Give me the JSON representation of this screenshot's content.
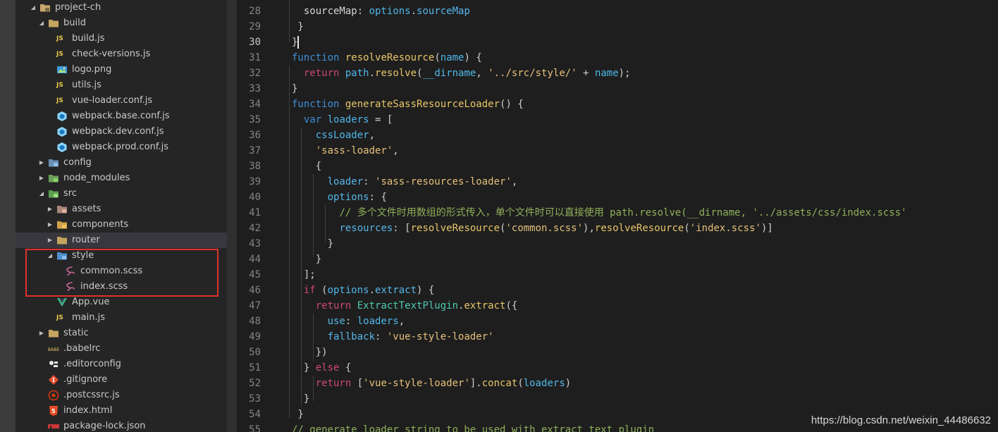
{
  "explorer": {
    "items": [
      {
        "label": "project-ch",
        "depth": 0,
        "type": "folder-open",
        "icon": "project-folder-icon"
      },
      {
        "label": "build",
        "depth": 1,
        "type": "folder-open",
        "icon": "folder-icon"
      },
      {
        "label": "build.js",
        "depth": 2,
        "type": "file",
        "icon": "js-file-icon"
      },
      {
        "label": "check-versions.js",
        "depth": 2,
        "type": "file",
        "icon": "js-file-icon"
      },
      {
        "label": "logo.png",
        "depth": 2,
        "type": "file",
        "icon": "image-file-icon"
      },
      {
        "label": "utils.js",
        "depth": 2,
        "type": "file",
        "icon": "js-file-icon"
      },
      {
        "label": "vue-loader.conf.js",
        "depth": 2,
        "type": "file",
        "icon": "js-file-icon"
      },
      {
        "label": "webpack.base.conf.js",
        "depth": 2,
        "type": "file",
        "icon": "webpack-icon"
      },
      {
        "label": "webpack.dev.conf.js",
        "depth": 2,
        "type": "file",
        "icon": "webpack-icon"
      },
      {
        "label": "webpack.prod.conf.js",
        "depth": 2,
        "type": "file",
        "icon": "webpack-icon"
      },
      {
        "label": "config",
        "depth": 1,
        "type": "folder-closed",
        "icon": "config-folder-icon"
      },
      {
        "label": "node_modules",
        "depth": 1,
        "type": "folder-closed",
        "icon": "node-folder-icon"
      },
      {
        "label": "src",
        "depth": 1,
        "type": "folder-open",
        "icon": "src-folder-icon"
      },
      {
        "label": "assets",
        "depth": 2,
        "type": "folder-closed",
        "icon": "assets-folder-icon"
      },
      {
        "label": "components",
        "depth": 2,
        "type": "folder-closed",
        "icon": "components-folder-icon"
      },
      {
        "label": "router",
        "depth": 2,
        "type": "folder-closed",
        "icon": "folder-icon",
        "selected": true
      },
      {
        "label": "style",
        "depth": 2,
        "type": "folder-open",
        "icon": "style-folder-icon"
      },
      {
        "label": "common.scss",
        "depth": 3,
        "type": "file",
        "icon": "sass-file-icon"
      },
      {
        "label": "index.scss",
        "depth": 3,
        "type": "file",
        "icon": "sass-file-icon"
      },
      {
        "label": "App.vue",
        "depth": 2,
        "type": "file",
        "icon": "vue-file-icon"
      },
      {
        "label": "main.js",
        "depth": 2,
        "type": "file",
        "icon": "js-file-icon"
      },
      {
        "label": "static",
        "depth": 1,
        "type": "folder-closed",
        "icon": "folder-icon"
      },
      {
        "label": ".babelrc",
        "depth": 1,
        "type": "file",
        "icon": "babel-file-icon"
      },
      {
        "label": ".editorconfig",
        "depth": 1,
        "type": "file",
        "icon": "editorconfig-icon"
      },
      {
        "label": ".gitignore",
        "depth": 1,
        "type": "file",
        "icon": "git-file-icon"
      },
      {
        "label": ".postcssrc.js",
        "depth": 1,
        "type": "file",
        "icon": "postcss-file-icon"
      },
      {
        "label": "index.html",
        "depth": 1,
        "type": "file",
        "icon": "html-file-icon"
      },
      {
        "label": "package-lock.json",
        "depth": 1,
        "type": "file",
        "icon": "npm-file-icon"
      }
    ],
    "js_badge": "JS"
  },
  "editor": {
    "current_line": 30,
    "lines": [
      {
        "n": "28",
        "tokens": [
          [
            "  ",
            ""
          ],
          [
            "sourceMap",
            ""
          ],
          [
            ": ",
            "punc"
          ],
          [
            "options",
            "var"
          ],
          [
            ".",
            "punc"
          ],
          [
            "sourceMap",
            "prop"
          ]
        ]
      },
      {
        "n": "29",
        "tokens": [
          [
            " }",
            "punc"
          ]
        ]
      },
      {
        "n": "30",
        "tokens": [
          [
            "}",
            "punc"
          ]
        ]
      },
      {
        "n": "31",
        "tokens": [
          [
            "function",
            "blue"
          ],
          [
            " ",
            ""
          ],
          [
            "resolveResource",
            "fn"
          ],
          [
            "(",
            "punc"
          ],
          [
            "name",
            "var"
          ],
          [
            ") {",
            "punc"
          ]
        ]
      },
      {
        "n": "32",
        "tokens": [
          [
            "  ",
            ""
          ],
          [
            "return",
            "kw"
          ],
          [
            " ",
            ""
          ],
          [
            "path",
            "var"
          ],
          [
            ".",
            "punc"
          ],
          [
            "resolve",
            "fn"
          ],
          [
            "(",
            "punc"
          ],
          [
            "__dirname",
            "var"
          ],
          [
            ", ",
            "punc"
          ],
          [
            "'../src/style/'",
            "str"
          ],
          [
            " + ",
            "punc"
          ],
          [
            "name",
            "var"
          ],
          [
            ");",
            "punc"
          ]
        ]
      },
      {
        "n": "33",
        "tokens": [
          [
            "}",
            "punc"
          ]
        ]
      },
      {
        "n": "34",
        "tokens": [
          [
            "function",
            "blue"
          ],
          [
            " ",
            ""
          ],
          [
            "generateSassResourceLoader",
            "fn"
          ],
          [
            "() {",
            "punc"
          ]
        ]
      },
      {
        "n": "35",
        "tokens": [
          [
            "  ",
            ""
          ],
          [
            "var",
            "blue"
          ],
          [
            " ",
            ""
          ],
          [
            "loaders",
            "var"
          ],
          [
            " = [",
            "punc"
          ]
        ]
      },
      {
        "n": "36",
        "tokens": [
          [
            "    ",
            ""
          ],
          [
            "cssLoader",
            "var"
          ],
          [
            ",",
            "punc"
          ]
        ]
      },
      {
        "n": "37",
        "tokens": [
          [
            "    ",
            ""
          ],
          [
            "'sass-loader'",
            "str"
          ],
          [
            ",",
            "punc"
          ]
        ]
      },
      {
        "n": "38",
        "tokens": [
          [
            "    ",
            ""
          ],
          [
            "{",
            "punc"
          ]
        ]
      },
      {
        "n": "39",
        "tokens": [
          [
            "      ",
            ""
          ],
          [
            "loader",
            "prop"
          ],
          [
            ": ",
            "punc"
          ],
          [
            "'sass-resources-loader'",
            "str"
          ],
          [
            ",",
            "punc"
          ]
        ]
      },
      {
        "n": "40",
        "tokens": [
          [
            "      ",
            ""
          ],
          [
            "options",
            "prop"
          ],
          [
            ": {",
            "punc"
          ]
        ]
      },
      {
        "n": "41",
        "tokens": [
          [
            "        ",
            ""
          ],
          [
            "// 多个文件时用数组的形式传入，单个文件时可以直接使用 path.resolve(__dirname, '../assets/css/index.scss'",
            "cm"
          ]
        ]
      },
      {
        "n": "42",
        "tokens": [
          [
            "        ",
            ""
          ],
          [
            "resources",
            "prop"
          ],
          [
            ": [",
            "punc"
          ],
          [
            "resolveResource",
            "fn"
          ],
          [
            "(",
            "punc"
          ],
          [
            "'common.scss'",
            "str"
          ],
          [
            "),",
            "punc"
          ],
          [
            "resolveResource",
            "fn"
          ],
          [
            "(",
            "punc"
          ],
          [
            "'index.scss'",
            "str"
          ],
          [
            ")]",
            "punc"
          ]
        ]
      },
      {
        "n": "43",
        "tokens": [
          [
            "      ",
            ""
          ],
          [
            "}",
            "punc"
          ]
        ]
      },
      {
        "n": "44",
        "tokens": [
          [
            "    ",
            ""
          ],
          [
            "}",
            "punc"
          ]
        ]
      },
      {
        "n": "45",
        "tokens": [
          [
            "  ",
            ""
          ],
          [
            "];",
            "punc"
          ]
        ]
      },
      {
        "n": "46",
        "tokens": [
          [
            "  ",
            ""
          ],
          [
            "if",
            "kw"
          ],
          [
            " (",
            "punc"
          ],
          [
            "options",
            "var"
          ],
          [
            ".",
            "punc"
          ],
          [
            "extract",
            "prop"
          ],
          [
            ") {",
            "punc"
          ]
        ]
      },
      {
        "n": "47",
        "tokens": [
          [
            "    ",
            ""
          ],
          [
            "return",
            "kw"
          ],
          [
            " ",
            ""
          ],
          [
            "ExtractTextPlugin",
            "cls"
          ],
          [
            ".",
            "punc"
          ],
          [
            "extract",
            "fn"
          ],
          [
            "({",
            "punc"
          ]
        ]
      },
      {
        "n": "48",
        "tokens": [
          [
            "      ",
            ""
          ],
          [
            "use",
            "prop"
          ],
          [
            ": ",
            "punc"
          ],
          [
            "loaders",
            "var"
          ],
          [
            ",",
            "punc"
          ]
        ]
      },
      {
        "n": "49",
        "tokens": [
          [
            "      ",
            ""
          ],
          [
            "fallback",
            "prop"
          ],
          [
            ": ",
            "punc"
          ],
          [
            "'vue-style-loader'",
            "str"
          ]
        ]
      },
      {
        "n": "50",
        "tokens": [
          [
            "    ",
            ""
          ],
          [
            "})",
            "punc"
          ]
        ]
      },
      {
        "n": "51",
        "tokens": [
          [
            "  ",
            ""
          ],
          [
            "} ",
            "punc"
          ],
          [
            "else",
            "kw"
          ],
          [
            " {",
            "punc"
          ]
        ]
      },
      {
        "n": "52",
        "tokens": [
          [
            "    ",
            ""
          ],
          [
            "return",
            "kw"
          ],
          [
            " [",
            "punc"
          ],
          [
            "'vue-style-loader'",
            "str"
          ],
          [
            "].",
            "punc"
          ],
          [
            "concat",
            "fn"
          ],
          [
            "(",
            "punc"
          ],
          [
            "loaders",
            "var"
          ],
          [
            ")",
            "punc"
          ]
        ]
      },
      {
        "n": "53",
        "tokens": [
          [
            "  ",
            ""
          ],
          [
            "}",
            "punc"
          ]
        ]
      },
      {
        "n": "54",
        "tokens": [
          [
            " }",
            "punc"
          ]
        ]
      },
      {
        "n": "55",
        "tokens": [
          [
            "// generate loader string to be used with extract text plugin",
            "cm"
          ]
        ]
      }
    ]
  },
  "watermark": "https://blog.csdn.net/weixin_44486632",
  "colors": {
    "sidebar_bg": "#252526",
    "editor_bg": "#1e1e1e",
    "highlight_border": "#e0312b",
    "selected_row": "#37373d"
  }
}
